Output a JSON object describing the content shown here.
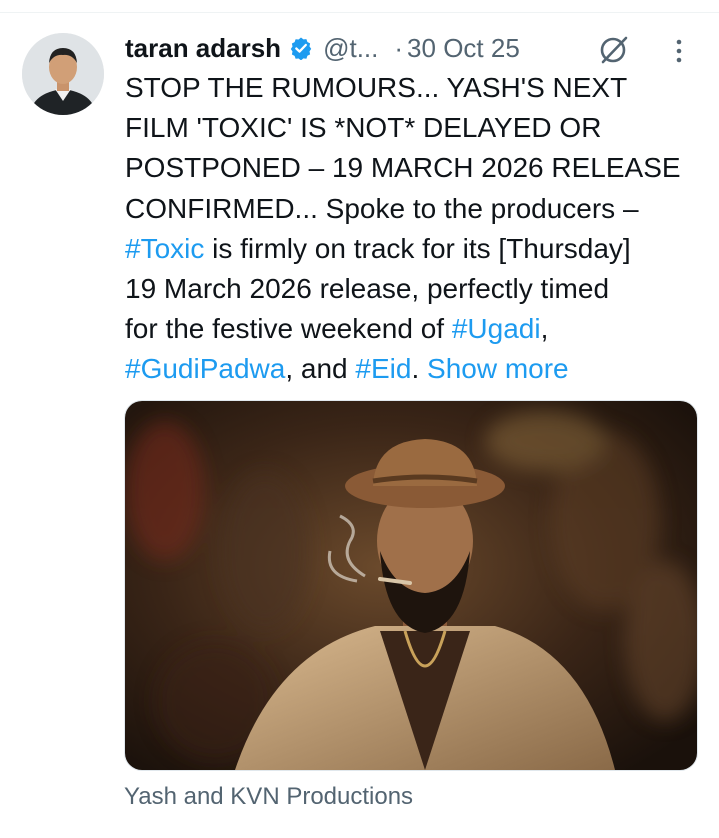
{
  "tweet": {
    "author_name": "taran adarsh",
    "handle": "@t...",
    "separator": "·",
    "date": "30 Oct 25",
    "icons": {
      "avatar": "profile-photo",
      "verified": "verified-badge-icon",
      "grok": "grok-icon",
      "more": "more-options-icon"
    },
    "lines": [
      [
        "STOP THE RUMOURS... YASH'S NEXT"
      ],
      [
        "FILM 'TOXIC' IS *NOT* DELAYED OR"
      ],
      [
        "POSTPONED – 19 MARCH 2026 RELEASE"
      ],
      [
        "CONFIRMED... Spoke to the producers –"
      ],
      [
        "is firmly on track for its [Thursday]"
      ],
      [
        "19 March 2026 release, perfectly timed"
      ],
      [
        "for the festive weekend of "
      ],
      [
        ", and "
      ]
    ],
    "hashtags": {
      "toxic": "#Toxic",
      "ugadi": "#Ugadi",
      "gudipadwa": "#GudiPadwa",
      "eid": "#Eid"
    },
    "punct_comma": ",",
    "punct_period": ".",
    "show_more": "Show more",
    "media_caption": "Yash and KVN Productions"
  },
  "colors": {
    "text": "#0f1419",
    "secondary": "#536471",
    "link": "#1d9bf0",
    "verified": "#1d9bf0"
  }
}
